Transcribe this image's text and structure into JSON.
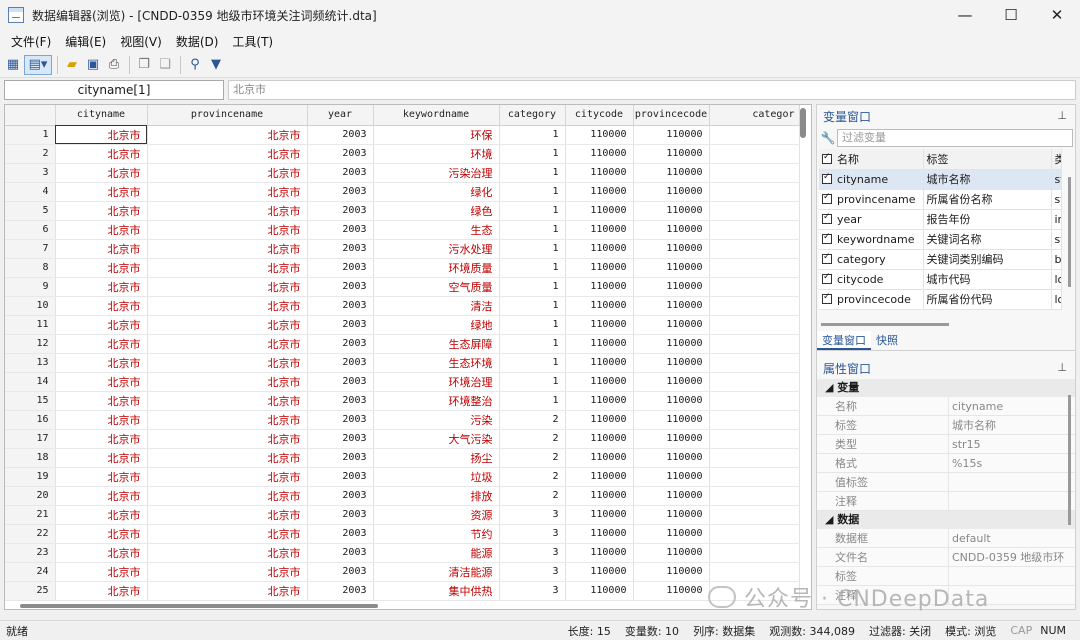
{
  "window": {
    "title": "数据编辑器(浏览) - [CNDD-0359 地级市环境关注词频统计.dta]",
    "min": "—",
    "max": "☐",
    "close": "✕"
  },
  "menu": [
    "文件(F)",
    "编辑(E)",
    "视图(V)",
    "数据(D)",
    "工具(T)"
  ],
  "current_var": "cityname[1]",
  "current_value": "北京市",
  "grid": {
    "columns": [
      "cityname",
      "provincename",
      "year",
      "keywordname",
      "category",
      "citycode",
      "provincecode",
      "categor"
    ],
    "rows": [
      [
        "北京市",
        "北京市",
        "2003",
        "环保",
        "1",
        "110000",
        "110000"
      ],
      [
        "北京市",
        "北京市",
        "2003",
        "环境",
        "1",
        "110000",
        "110000"
      ],
      [
        "北京市",
        "北京市",
        "2003",
        "污染治理",
        "1",
        "110000",
        "110000"
      ],
      [
        "北京市",
        "北京市",
        "2003",
        "绿化",
        "1",
        "110000",
        "110000"
      ],
      [
        "北京市",
        "北京市",
        "2003",
        "绿色",
        "1",
        "110000",
        "110000"
      ],
      [
        "北京市",
        "北京市",
        "2003",
        "生态",
        "1",
        "110000",
        "110000"
      ],
      [
        "北京市",
        "北京市",
        "2003",
        "污水处理",
        "1",
        "110000",
        "110000"
      ],
      [
        "北京市",
        "北京市",
        "2003",
        "环境质量",
        "1",
        "110000",
        "110000"
      ],
      [
        "北京市",
        "北京市",
        "2003",
        "空气质量",
        "1",
        "110000",
        "110000"
      ],
      [
        "北京市",
        "北京市",
        "2003",
        "清洁",
        "1",
        "110000",
        "110000"
      ],
      [
        "北京市",
        "北京市",
        "2003",
        "绿地",
        "1",
        "110000",
        "110000"
      ],
      [
        "北京市",
        "北京市",
        "2003",
        "生态屏障",
        "1",
        "110000",
        "110000"
      ],
      [
        "北京市",
        "北京市",
        "2003",
        "生态环境",
        "1",
        "110000",
        "110000"
      ],
      [
        "北京市",
        "北京市",
        "2003",
        "环境治理",
        "1",
        "110000",
        "110000"
      ],
      [
        "北京市",
        "北京市",
        "2003",
        "环境整治",
        "1",
        "110000",
        "110000"
      ],
      [
        "北京市",
        "北京市",
        "2003",
        "污染",
        "2",
        "110000",
        "110000"
      ],
      [
        "北京市",
        "北京市",
        "2003",
        "大气污染",
        "2",
        "110000",
        "110000"
      ],
      [
        "北京市",
        "北京市",
        "2003",
        "扬尘",
        "2",
        "110000",
        "110000"
      ],
      [
        "北京市",
        "北京市",
        "2003",
        "垃圾",
        "2",
        "110000",
        "110000"
      ],
      [
        "北京市",
        "北京市",
        "2003",
        "排放",
        "2",
        "110000",
        "110000"
      ],
      [
        "北京市",
        "北京市",
        "2003",
        "资源",
        "3",
        "110000",
        "110000"
      ],
      [
        "北京市",
        "北京市",
        "2003",
        "节约",
        "3",
        "110000",
        "110000"
      ],
      [
        "北京市",
        "北京市",
        "2003",
        "能源",
        "3",
        "110000",
        "110000"
      ],
      [
        "北京市",
        "北京市",
        "2003",
        "清洁能源",
        "3",
        "110000",
        "110000"
      ],
      [
        "北京市",
        "北京市",
        "2003",
        "集中供热",
        "3",
        "110000",
        "110000"
      ]
    ]
  },
  "var_window": {
    "title": "变量窗口",
    "filter_placeholder": "过滤变量",
    "head": [
      "名称",
      "标签",
      "类"
    ],
    "vars": [
      [
        "cityname",
        "城市名称",
        "st"
      ],
      [
        "provincename",
        "所属省份名称",
        "st"
      ],
      [
        "year",
        "报告年份",
        "in"
      ],
      [
        "keywordname",
        "关键词名称",
        "st"
      ],
      [
        "category",
        "关键词类别编码",
        "b"
      ],
      [
        "citycode",
        "城市代码",
        "lo"
      ],
      [
        "provincecode",
        "所属省份代码",
        "lo"
      ]
    ],
    "tabs": [
      "变量窗口",
      "快照"
    ]
  },
  "props": {
    "title": "属性窗口",
    "var_section": "变量",
    "var_rows": [
      [
        "名称",
        "cityname"
      ],
      [
        "标签",
        "城市名称"
      ],
      [
        "类型",
        "str15"
      ],
      [
        "格式",
        "%15s"
      ],
      [
        "值标签",
        ""
      ],
      [
        "注释",
        ""
      ]
    ],
    "data_section": "数据",
    "data_rows": [
      [
        "数据框",
        "default"
      ],
      [
        "文件名",
        "CNDD-0359 地级市环"
      ],
      [
        "标签",
        ""
      ],
      [
        "注释",
        ""
      ]
    ]
  },
  "watermark": "公众号 · CNDeepData",
  "status": {
    "left": "就绪",
    "length": "长度: 15",
    "vars": "变量数: 10",
    "order": "列序: 数据集",
    "obs": "观测数: 344,089",
    "filter": "过滤器: 关闭",
    "mode": "模式: 浏览",
    "cap": "CAP",
    "num": "NUM"
  }
}
